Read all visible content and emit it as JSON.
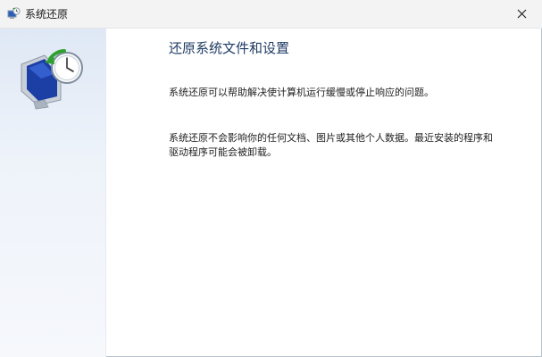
{
  "window": {
    "title": "系统还原",
    "icon": "system-restore-icon",
    "close_icon": "close-icon"
  },
  "sidebar": {
    "hero_icon": "system-restore-monitor-icon"
  },
  "main": {
    "heading": "还原系统文件和设置",
    "paragraphs": [
      "系统还原可以帮助解决使计算机运行缓慢或停止响应的问题。",
      "系统还原不会影响你的任何文档、图片或其他个人数据。最近安装的程序和驱动程序可能会被卸载。"
    ]
  },
  "colors": {
    "heading": "#1f3b64",
    "sidebar": "#e6edf7",
    "titlebar": "#f3f3f3"
  }
}
